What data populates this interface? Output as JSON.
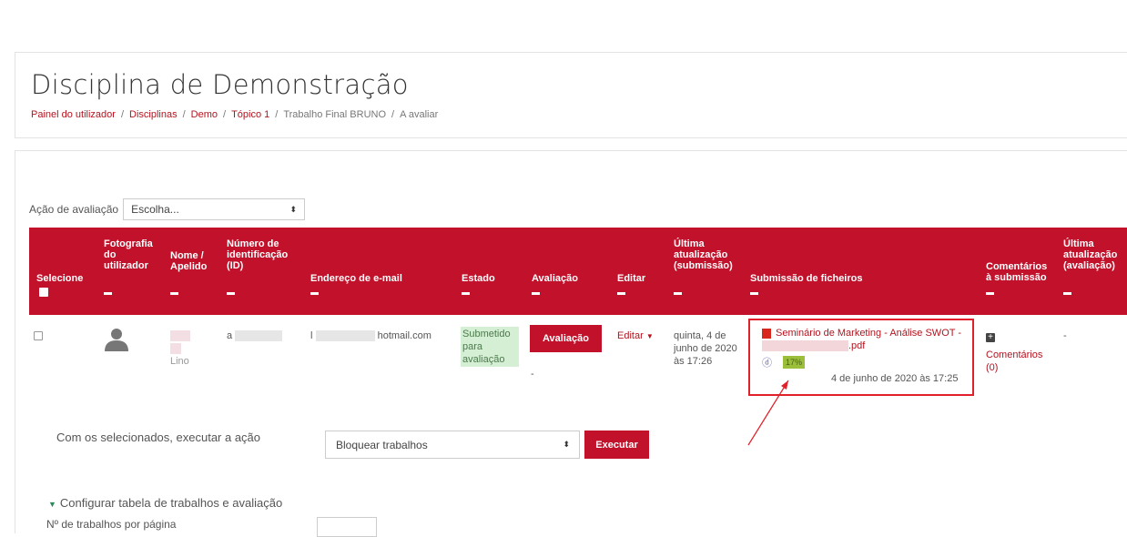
{
  "page": {
    "title": "Disciplina de Demonstração",
    "breadcrumb": [
      "Painel do utilizador",
      "Disciplinas",
      "Demo",
      "Tópico 1",
      "Trabalho Final BRUNO",
      "A avaliar"
    ]
  },
  "grading_action": {
    "label": "Ação de avaliação",
    "selected": "Escolha..."
  },
  "table": {
    "headers": {
      "select": "Selecione",
      "photo": "Fotografia do utilizador",
      "name": "Nome / Apelido",
      "idnum": "Número de identificação (ID)",
      "email": "Endereço de e-mail",
      "status": "Estado",
      "grade": "Avaliação",
      "edit": "Editar",
      "last_modified_sub": "Última atualização (submissão)",
      "files": "Submissão de ficheiros",
      "comments": "Comentários à submissão",
      "last_modified_grade": "Última atualização (avaliação)"
    },
    "row": {
      "name_suffix": "Lino",
      "idnum_prefix": "a",
      "email_prefix": "l",
      "email_domain": "hotmail.com",
      "status": "Submetido para avaliação",
      "grade_button": "Avaliação",
      "grade_value": "-",
      "edit_menu": "Editar",
      "last_modified_sub": "quinta, 4 de junho de 2020 às 17:26",
      "file_name": "Seminário de Marketing - Análise SWOT - ",
      "file_ext": ".pdf",
      "plagiarism_score": "17%",
      "file_date": "4 de junho de 2020 às 17:25",
      "comments_label": "Comentários",
      "comments_count": "(0)",
      "last_modified_grade": "-"
    }
  },
  "bulk": {
    "label": "Com os selecionados, executar a ação",
    "selected": "Bloquear trabalhos",
    "execute": "Executar"
  },
  "options": {
    "toggle": "Configurar tabela de trabalhos e avaliação",
    "per_page": "Nº de trabalhos por página"
  },
  "colors": {
    "brand": "#c2112a",
    "status_bg": "#d4efd4",
    "annotation": "#e0202a"
  }
}
